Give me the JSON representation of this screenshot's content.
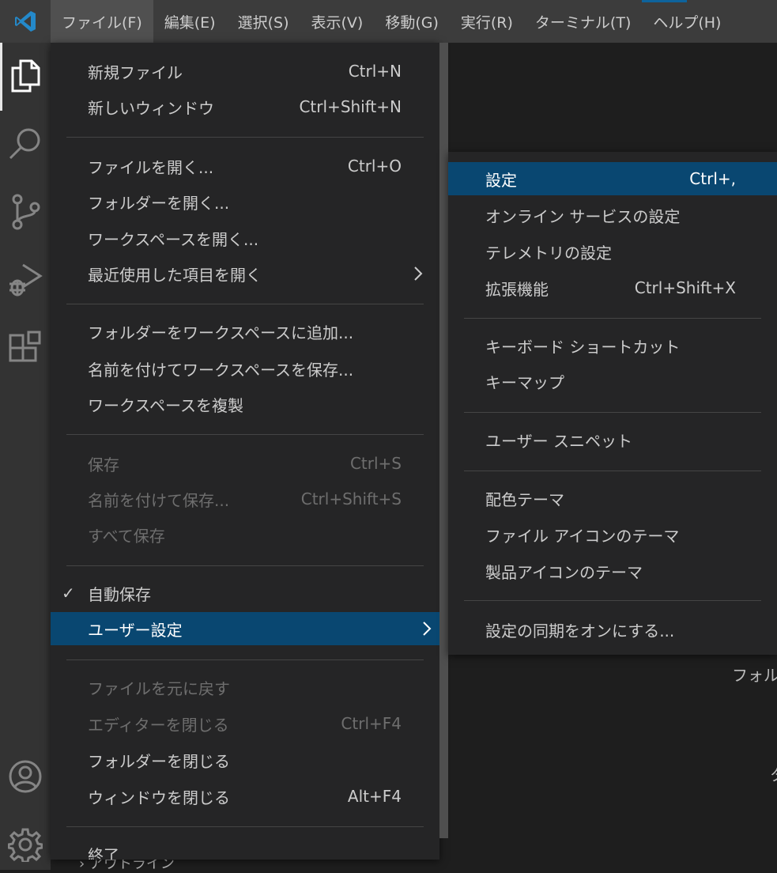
{
  "menubar": {
    "items": [
      "ファイル(F)",
      "編集(E)",
      "選択(S)",
      "表示(V)",
      "移動(G)",
      "実行(R)",
      "ターミナル(T)",
      "ヘルプ(H)"
    ]
  },
  "activity": {
    "icons": [
      "explorer-icon",
      "search-icon",
      "source-control-icon",
      "run-debug-icon",
      "extensions-icon",
      "account-icon",
      "manage-gear-icon"
    ]
  },
  "file_menu": {
    "new_file": {
      "label": "新規ファイル",
      "kb": "Ctrl+N"
    },
    "new_window": {
      "label": "新しいウィンドウ",
      "kb": "Ctrl+Shift+N"
    },
    "open_file": {
      "label": "ファイルを開く...",
      "kb": "Ctrl+O"
    },
    "open_folder": {
      "label": "フォルダーを開く..."
    },
    "open_workspace": {
      "label": "ワークスペースを開く..."
    },
    "open_recent": {
      "label": "最近使用した項目を開く"
    },
    "add_folder": {
      "label": "フォルダーをワークスペースに追加..."
    },
    "save_workspace_as": {
      "label": "名前を付けてワークスペースを保存..."
    },
    "duplicate_workspace": {
      "label": "ワークスペースを複製"
    },
    "save": {
      "label": "保存",
      "kb": "Ctrl+S"
    },
    "save_as": {
      "label": "名前を付けて保存...",
      "kb": "Ctrl+Shift+S"
    },
    "save_all": {
      "label": "すべて保存"
    },
    "auto_save": {
      "label": "自動保存",
      "check": "✓"
    },
    "preferences": {
      "label": "ユーザー設定"
    },
    "revert": {
      "label": "ファイルを元に戻す"
    },
    "close_editor": {
      "label": "エディターを閉じる",
      "kb": "Ctrl+F4"
    },
    "close_folder": {
      "label": "フォルダーを閉じる"
    },
    "close_window": {
      "label": "ウィンドウを閉じる",
      "kb": "Alt+F4"
    },
    "exit": {
      "label": "終了"
    }
  },
  "prefs_menu": {
    "settings": {
      "label": "設定",
      "kb": "Ctrl+,"
    },
    "online_services": {
      "label": "オンライン サービスの設定"
    },
    "telemetry": {
      "label": "テレメトリの設定"
    },
    "extensions": {
      "label": "拡張機能",
      "kb": "Ctrl+Shift+X"
    },
    "keyboard_shortcuts": {
      "label": "キーボード ショートカット"
    },
    "keymaps": {
      "label": "キーマップ"
    },
    "user_snippets": {
      "label": "ユーザー スニペット"
    },
    "color_theme": {
      "label": "配色テーマ"
    },
    "file_icon_theme": {
      "label": "ファイル アイコンのテーマ"
    },
    "product_icon_theme": {
      "label": "製品アイコンのテーマ"
    },
    "settings_sync": {
      "label": "設定の同期をオンにする..."
    }
  },
  "background": {
    "folder_text": "フォル",
    "outline_text": "アウトライン",
    "partial_char": "タ"
  }
}
